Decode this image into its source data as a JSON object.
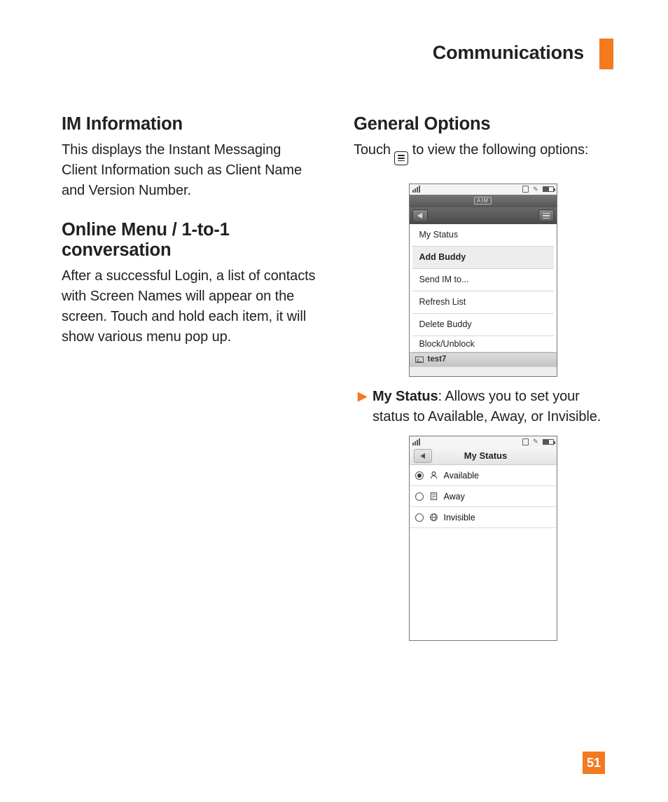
{
  "chapter": "Communications",
  "page_number": "51",
  "accent_color": "#f47a1f",
  "left": {
    "h1": "IM Information",
    "p1": "This displays the Instant Messaging Client Information such as Client Name and Version Number.",
    "h2": "Online Menu / 1-to-1 conversation",
    "p2": "After a successful Login, a list of contacts with Screen Names will appear on the screen. Touch and hold each item, it will show various menu pop up."
  },
  "right": {
    "h1": "General Options",
    "p1_a": "Touch ",
    "p1_b": " to view the following options:",
    "bullet_title": "My Status",
    "bullet_text": ": Allows you to set your status to Available, Away, or Invisible."
  },
  "shot1": {
    "app_badge": "AIM",
    "popup_items": [
      "My Status",
      "Add Buddy",
      "Send IM to...",
      "Refresh List",
      "Delete Buddy",
      "Block/Unblock"
    ],
    "selected_index": 1,
    "nowplaying": "test7"
  },
  "shot2": {
    "title": "My Status",
    "options": [
      {
        "label": "Available",
        "selected": true,
        "icon": "person"
      },
      {
        "label": "Away",
        "selected": false,
        "icon": "paper"
      },
      {
        "label": "Invisible",
        "selected": false,
        "icon": "globe"
      }
    ]
  }
}
